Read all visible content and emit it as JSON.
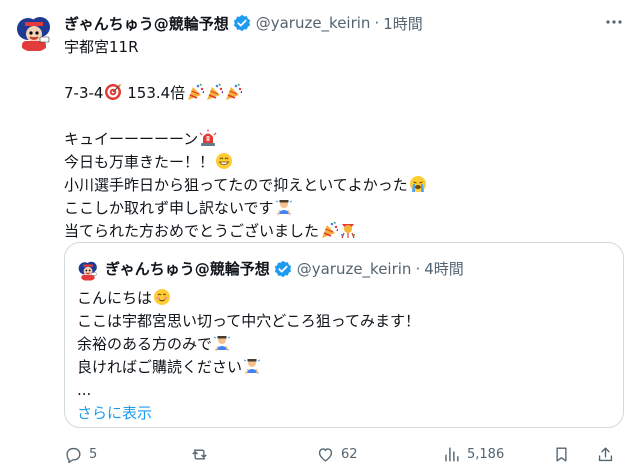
{
  "tweet": {
    "display_name": "ぎゃんちゅう@競輪予想",
    "handle": "@yaruze_keirin",
    "separator": "·",
    "time": "1時間",
    "lines": [
      "宇都宮11R",
      "",
      "7-3-4",
      " 153.4倍",
      "",
      "キュイーーーーーン",
      "今日も万車きたー！！",
      "小川選手昨日から狙ってたので抑えといてよかった",
      "ここしか取れず申し訳ないです",
      "当てられた方おめでとうございました"
    ]
  },
  "quoted": {
    "display_name": "ぎゃんちゅう@競輪予想",
    "handle": "@yaruze_keirin",
    "separator": "·",
    "time": "4時間",
    "lines": [
      "こんにちは",
      "ここは宇都宮思い切って中穴どころ狙ってみます！",
      "余裕のある方のみで",
      "良ければご購読ください",
      "..."
    ],
    "show_more": "さらに表示"
  },
  "actions": {
    "replies": "5",
    "retweets": "",
    "likes": "62",
    "views": "5,186"
  },
  "icons": {
    "verified": "verified-badge-icon",
    "more": "more-icon",
    "reply": "reply-icon",
    "retweet": "retweet-icon",
    "like": "heart-icon",
    "views": "views-chart-icon",
    "bookmark": "bookmark-icon",
    "share": "share-icon"
  },
  "colors": {
    "text": "#0f1419",
    "muted": "#536471",
    "accent": "#1d9bf0",
    "border": "#cfd9de"
  }
}
